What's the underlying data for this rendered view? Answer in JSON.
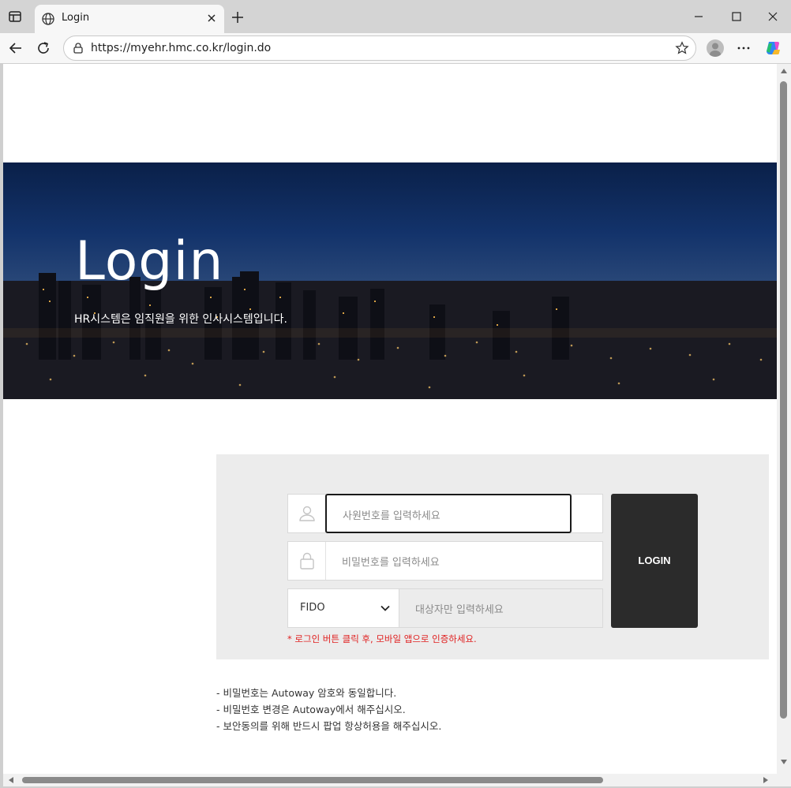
{
  "browser": {
    "tab_title": "Login",
    "url": "https://myehr.hmc.co.kr/login.do"
  },
  "hero": {
    "title": "Login",
    "subtitle": "HR시스템은 임직원을 위한 인사시스템입니다."
  },
  "login": {
    "id_placeholder": "사원번호를 입력하세요",
    "pw_placeholder": "비밀번호를 입력하세요",
    "auth_selected": "FIDO",
    "fido_placeholder": "대상자만 입력하세요",
    "fido_note": "* 로그인 버튼 클릭 후, 모바일 앱으로 인증하세요.",
    "button_label": "LOGIN"
  },
  "notes": [
    "- 비밀번호는 Autoway 암호와 동일합니다.",
    "- 비밀번호 변경은 Autoway에서 해주십시오.",
    "- 보안동의를 위해 반드시 팝업 항상허용을 해주십시오."
  ],
  "colors": {
    "accent_button": "#2b2b2b",
    "note_red": "#e02020",
    "panel_bg": "#ececec"
  },
  "icons": [
    "tab-actions-icon",
    "globe-icon",
    "close-icon",
    "plus-icon",
    "minimize-icon",
    "maximize-icon",
    "back-icon",
    "reload-icon",
    "lock-icon",
    "star-icon",
    "profile-icon",
    "more-icon",
    "copilot-icon",
    "user-icon",
    "padlock-icon",
    "chevron-down-icon"
  ]
}
